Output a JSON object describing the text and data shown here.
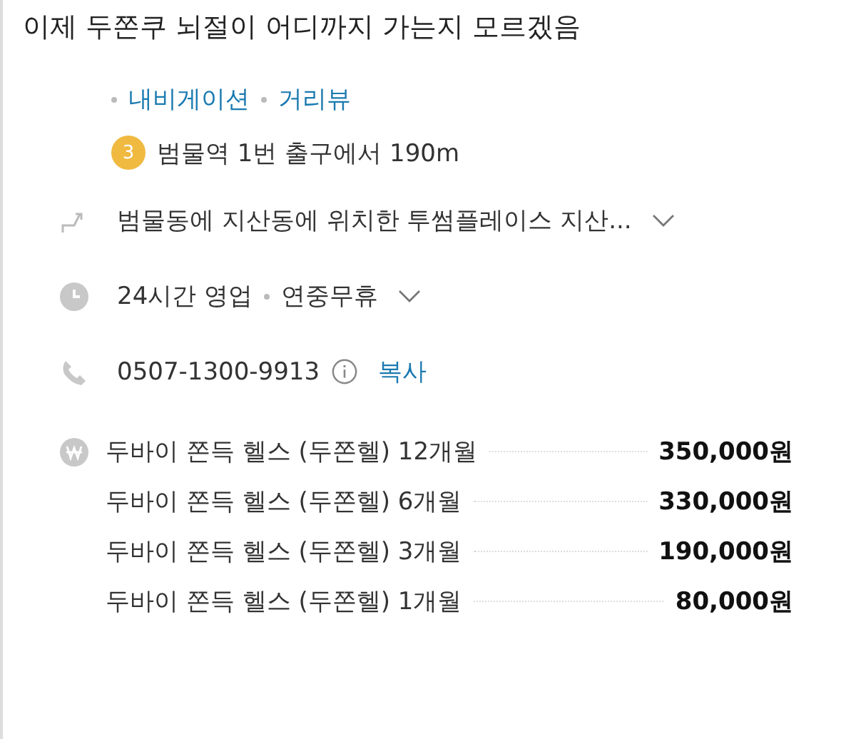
{
  "post_title": "이제 두쫀쿠 뇌절이 어디까지 가는지 모르겠음",
  "links": [
    "내비게이션",
    "거리뷰"
  ],
  "station": {
    "number": "3",
    "text": "범물역 1번 출구에서 190m"
  },
  "address": {
    "text": "범물동에 지산동에 위치한 투썸플레이스 지산...",
    "expanded": false
  },
  "hours": {
    "status": "24시간 영업",
    "note": "연중무휴",
    "expanded": false
  },
  "phone": {
    "number": "0507-1300-9913",
    "copy": "복사"
  },
  "prices": [
    {
      "item": "두바이 쫀득 헬스 (두쫀헬) 12개월",
      "price": "350,000원"
    },
    {
      "item": "두바이 쫀득 헬스 (두쫀헬) 6개월",
      "price": "330,000원"
    },
    {
      "item": "두바이 쫀득 헬스 (두쫀헬) 3개월",
      "price": "190,000원"
    },
    {
      "item": "두바이 쫀득 헬스 (두쫀헬) 1개월",
      "price": "80,000원"
    }
  ]
}
